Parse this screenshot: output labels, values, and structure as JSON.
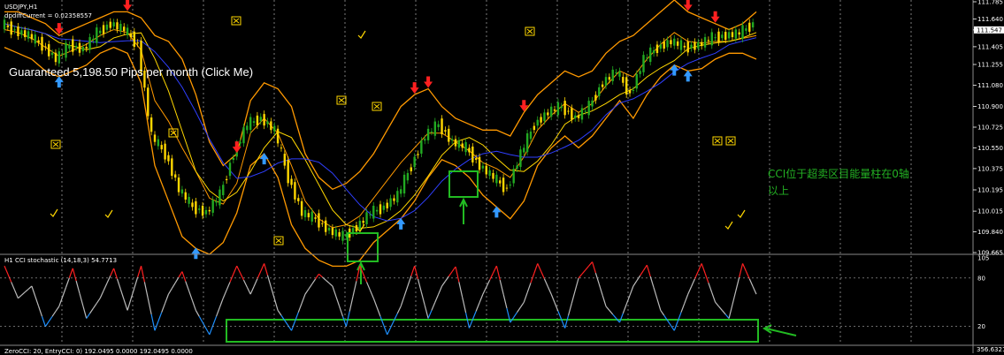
{
  "chart_header": {
    "symbol_line": "USDJPY,H1",
    "indicator_line": "dpdiffCurrent = 0.02358557"
  },
  "promo_link": "Guaranteed 5,198.50 Pips per month (Click Me)",
  "annotation": "CCI位于超卖区目能量柱在0轴\n以上",
  "oscillator_header": "H1 CCI stochastic (14,18,3) 54.7713",
  "bottom_header": "ZeroCCI: 20, EntryCCI: 0) 192.0495 0.0000 192.0495 0.0000",
  "colors": {
    "background": "#000000",
    "bollinger": "#ff9900",
    "ma_fast": "#ffd700",
    "ma_slow": "#2f3fff",
    "candle_up": "#22aa22",
    "candle_down": "#ffd700",
    "sell_arrow": "#ff2020",
    "buy_arrow": "#3399ff",
    "highlight_box": "#22bb22",
    "cci_high": "#ff2020",
    "cci_mid": "#bbbbbb",
    "cci_low": "#1e90ff",
    "sell_flag": "#ffd700",
    "buy_check": "#ffd700"
  },
  "chart_data": [
    {
      "type": "candlestick",
      "title": "USDJPY,H1",
      "series": [
        {
          "name": "price",
          "values": [
            111.6,
            111.54,
            111.5,
            111.42,
            111.3,
            111.42,
            111.38,
            111.52,
            111.6,
            111.55,
            111.42,
            110.65,
            110.5,
            110.2,
            110.05,
            110.0,
            110.15,
            110.5,
            110.75,
            110.8,
            110.7,
            110.3,
            110.0,
            109.95,
            109.85,
            109.8,
            109.88,
            110.0,
            110.05,
            110.15,
            110.4,
            110.65,
            110.75,
            110.6,
            110.55,
            110.4,
            110.3,
            110.2,
            110.5,
            110.75,
            110.85,
            110.9,
            110.8,
            110.9,
            111.1,
            111.2,
            111.0,
            111.3,
            111.4,
            111.45,
            111.4,
            111.42,
            111.48,
            111.5,
            111.52,
            111.6
          ]
        },
        {
          "name": "bollinger_upper",
          "values": [
            111.7,
            111.7,
            111.65,
            111.6,
            111.5,
            111.55,
            111.6,
            111.65,
            111.7,
            111.7,
            111.65,
            111.5,
            111.45,
            111.3,
            111.0,
            110.6,
            110.4,
            110.5,
            110.95,
            111.1,
            111.05,
            110.9,
            110.5,
            110.3,
            110.2,
            110.25,
            110.35,
            110.5,
            110.7,
            110.9,
            111.0,
            111.05,
            110.9,
            110.8,
            110.75,
            110.7,
            110.7,
            110.65,
            110.85,
            111.0,
            111.1,
            111.2,
            111.15,
            111.2,
            111.35,
            111.45,
            111.5,
            111.6,
            111.7,
            111.8,
            111.7,
            111.65,
            111.6,
            111.55,
            111.6,
            111.7
          ]
        },
        {
          "name": "bollinger_lower",
          "values": [
            111.4,
            111.35,
            111.3,
            111.2,
            111.15,
            111.2,
            111.25,
            111.35,
            111.4,
            111.35,
            111.1,
            110.4,
            110.1,
            109.8,
            109.7,
            109.65,
            109.75,
            110.0,
            110.4,
            110.5,
            110.3,
            109.9,
            109.7,
            109.6,
            109.55,
            109.55,
            109.6,
            109.75,
            109.85,
            109.95,
            110.1,
            110.3,
            110.45,
            110.4,
            110.3,
            110.15,
            110.05,
            109.95,
            110.1,
            110.4,
            110.55,
            110.65,
            110.55,
            110.65,
            110.8,
            110.95,
            110.8,
            111.0,
            111.15,
            111.25,
            111.2,
            111.22,
            111.3,
            111.35,
            111.35,
            111.3
          ]
        }
      ],
      "ylim": [
        109.665,
        111.785
      ],
      "ytick_labels": [
        "111.785",
        "111.640",
        "111.547",
        "111.405",
        "111.255",
        "111.080",
        "110.900",
        "110.725",
        "110.550",
        "110.375",
        "110.195",
        "110.015",
        "109.840",
        "109.665"
      ],
      "current_price": "111.547",
      "sell_signal_indices": [
        4,
        9,
        17,
        30,
        31,
        38,
        50,
        52
      ],
      "buy_signal_indices": [
        4,
        14,
        19,
        29,
        36,
        49,
        50
      ]
    },
    {
      "type": "line",
      "title": "H1 CCI stochastic (14,18,3) 54.7713",
      "series": [
        {
          "name": "cci_stochastic",
          "values": [
            95,
            55,
            70,
            20,
            45,
            92,
            30,
            55,
            92,
            40,
            95,
            15,
            60,
            88,
            40,
            10,
            55,
            95,
            60,
            98,
            40,
            15,
            60,
            85,
            70,
            20,
            95,
            55,
            10,
            45,
            95,
            30,
            70,
            94,
            18,
            60,
            95,
            25,
            50,
            98,
            60,
            18,
            80,
            100,
            45,
            25,
            70,
            96,
            40,
            15,
            60,
            98,
            50,
            30,
            98,
            60
          ]
        }
      ],
      "ylim": [
        0,
        105
      ],
      "ytick_labels": [
        "105",
        "80",
        "20"
      ],
      "overbought": 80,
      "oversold": 20
    },
    {
      "type": "bar",
      "title": "ZeroCCI: 20, EntryCCI: 0) 192.0495 0.0000 192.0495 0.0000",
      "ytick_labels": [
        "356.6321"
      ]
    }
  ]
}
